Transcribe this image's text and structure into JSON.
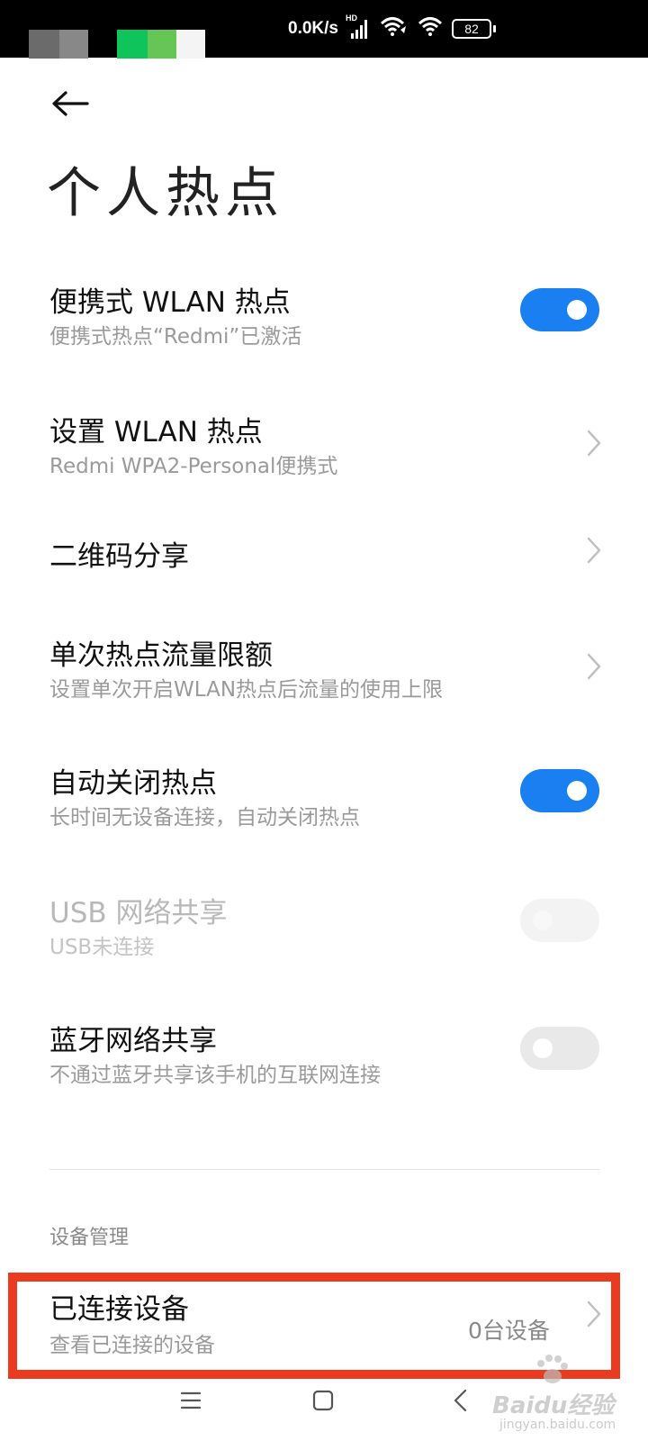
{
  "status_bar": {
    "network_speed": "0.0K/s",
    "signal_badge": "HD",
    "battery_level": "82",
    "icons": [
      "signal-icon",
      "wifi-calling-icon",
      "wifi-icon",
      "battery-icon"
    ]
  },
  "header": {
    "back_icon": "back-arrow-icon",
    "title": "个人热点"
  },
  "settings": [
    {
      "title": "便携式 WLAN 热点",
      "subtitle": "便携式热点“Redmi”已激活",
      "control": "toggle",
      "state": "on"
    },
    {
      "title": "设置 WLAN 热点",
      "subtitle": "Redmi WPA2-Personal便携式",
      "control": "chevron"
    },
    {
      "title": "二维码分享",
      "control": "chevron"
    },
    {
      "title": "单次热点流量限额",
      "subtitle": "设置单次开启WLAN热点后流量的使用上限",
      "control": "chevron"
    },
    {
      "title": "自动关闭热点",
      "subtitle": "长时间无设备连接，自动关闭热点",
      "control": "toggle",
      "state": "on"
    },
    {
      "title": "USB 网络共享",
      "subtitle": "USB未连接",
      "control": "toggle",
      "state": "off",
      "enabled": false
    },
    {
      "title": "蓝牙网络共享",
      "subtitle": "不通过蓝牙共享该手机的互联网连接",
      "control": "toggle",
      "state": "off"
    }
  ],
  "device_section": {
    "label": "设备管理",
    "connected": {
      "title": "已连接设备",
      "subtitle": "查看已连接的设备",
      "value": "0台设备"
    }
  },
  "nav_bar": {
    "icons": [
      "menu-icon",
      "home-icon",
      "back-icon"
    ]
  },
  "watermark": {
    "brand": "Baidu经验",
    "url": "jingyan.baidu.com"
  },
  "colors": {
    "accent": "#1a7ff0",
    "highlight": "#ea3b21",
    "status_bar_bg": "#000000"
  }
}
